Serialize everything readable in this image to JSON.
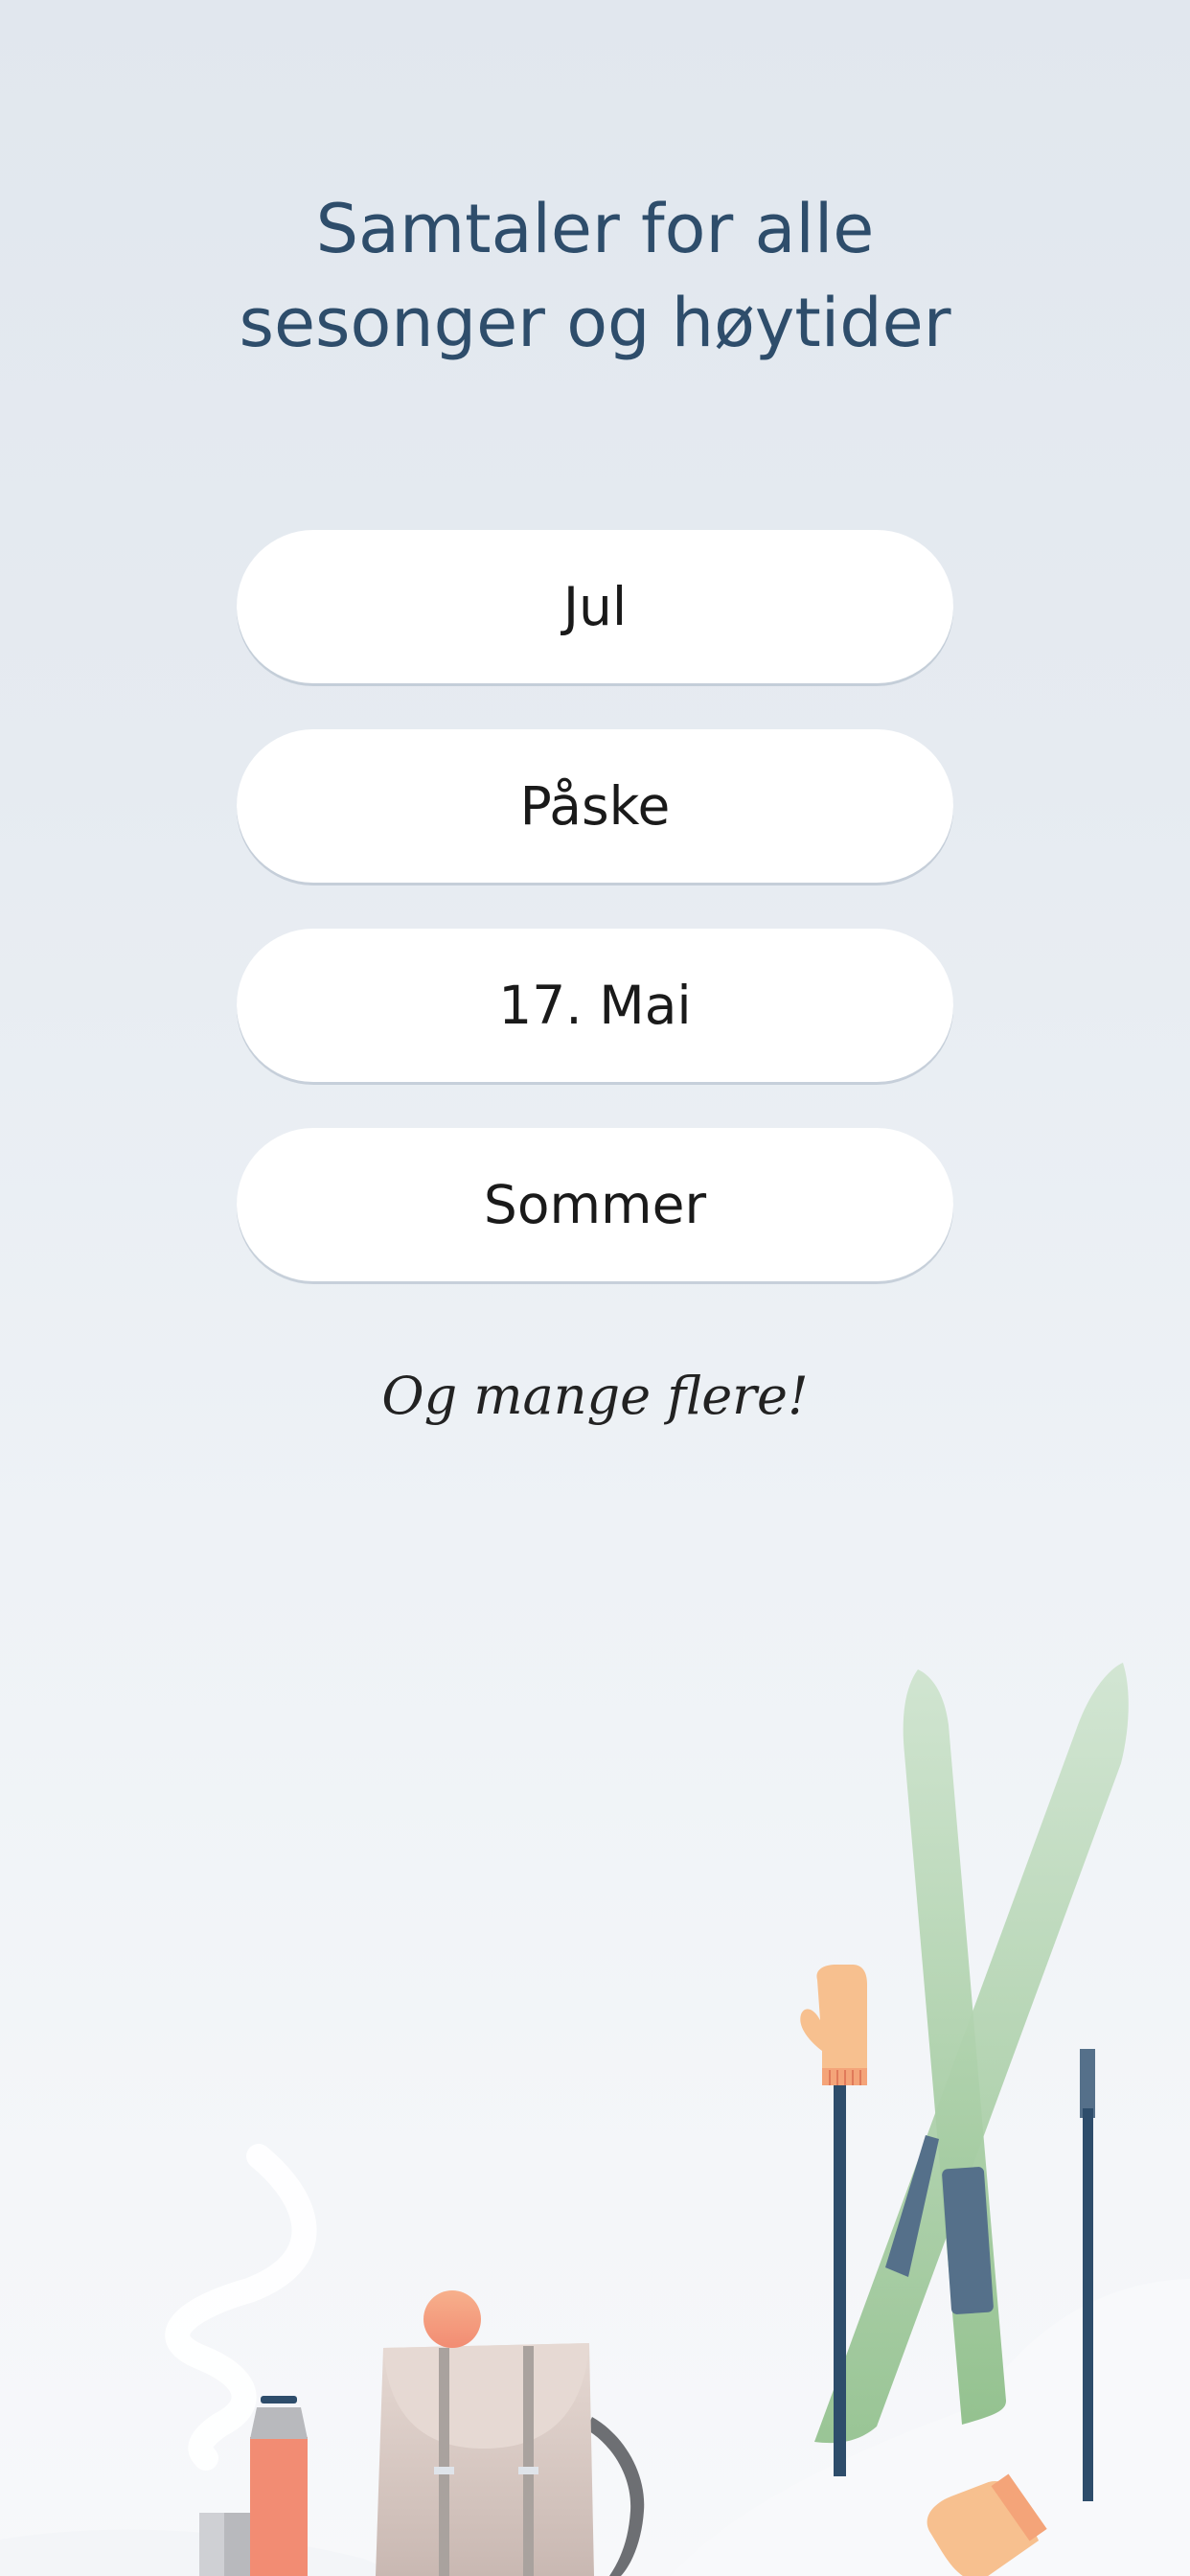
{
  "header": {
    "title_line1": "Samtaler for alle",
    "title_line2": "sesonger og høytider"
  },
  "options": [
    {
      "label": "Jul"
    },
    {
      "label": "Påske"
    },
    {
      "label": "17. Mai"
    },
    {
      "label": "Sommer"
    }
  ],
  "footer_note": "Og mange flere!",
  "colors": {
    "title": "#2e4d6b",
    "button_bg": "#ffffff",
    "button_text": "#1a1a1a",
    "ski": "#a9cfa6",
    "pole": "#2e4d6b",
    "mitten": "#f7c08f",
    "thermos": "#f28c73",
    "backpack": "#d9cbc5"
  }
}
